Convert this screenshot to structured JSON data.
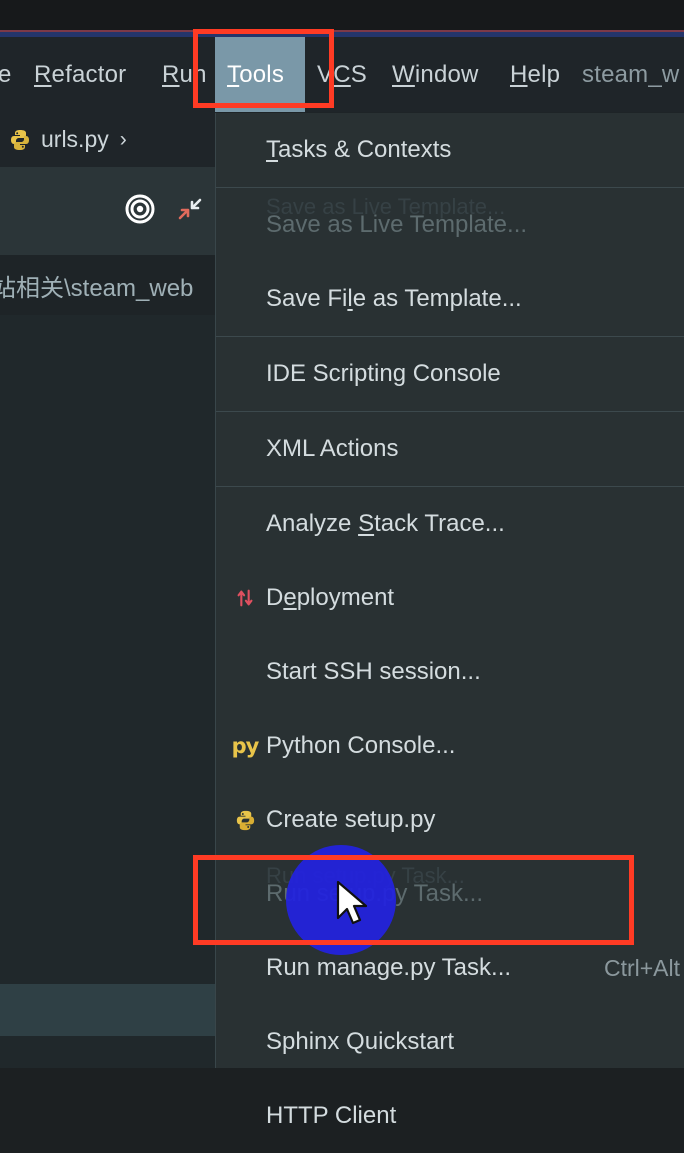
{
  "app": {
    "menubar": [
      {
        "label": "e",
        "mnemonic": "",
        "state": "clipped"
      },
      {
        "label": "Refactor",
        "mnemonic": "R",
        "state": "normal"
      },
      {
        "label": "Run",
        "mnemonic": "R",
        "state": "normal"
      },
      {
        "label": "Tools",
        "mnemonic": "T",
        "state": "selected"
      },
      {
        "label": "VCS",
        "mnemonic": "C",
        "state": "normal"
      },
      {
        "label": "Window",
        "mnemonic": "W",
        "state": "normal"
      },
      {
        "label": "Help",
        "mnemonic": "H",
        "state": "normal"
      },
      {
        "label": "steam_w",
        "mnemonic": "",
        "state": "dim"
      }
    ]
  },
  "editor": {
    "breadcrumb": {
      "icon": "python-file-icon",
      "file": "urls.py",
      "chevron": "›"
    },
    "toolbar": {
      "target_icon": "scroll-to-source-icon",
      "collapse_icon": "collapse-all-icon"
    },
    "path": "站相关\\steam_web"
  },
  "menu": {
    "title": "Tools",
    "items": [
      {
        "label": "Tasks & Contexts",
        "mnemonic": "T",
        "icon": "",
        "shortcut": "",
        "disabled": false,
        "separator_after": true,
        "ghost": ""
      },
      {
        "label": "Save as Live Template...",
        "mnemonic": "",
        "icon": "",
        "shortcut": "",
        "disabled": true,
        "separator_after": false,
        "ghost": "Save as Live Template..."
      },
      {
        "label": "Save File as Template...",
        "mnemonic": "l",
        "icon": "",
        "shortcut": "",
        "disabled": false,
        "separator_after": true,
        "ghost": ""
      },
      {
        "label": "IDE Scripting Console",
        "mnemonic": "",
        "icon": "",
        "shortcut": "",
        "disabled": false,
        "separator_after": true,
        "ghost": ""
      },
      {
        "label": "XML Actions",
        "mnemonic": "",
        "icon": "",
        "shortcut": "",
        "disabled": false,
        "separator_after": true,
        "ghost": ""
      },
      {
        "label": "Analyze Stack Trace...",
        "mnemonic": "S",
        "icon": "",
        "shortcut": "",
        "disabled": false,
        "separator_after": false,
        "ghost": ""
      },
      {
        "label": "Deployment",
        "mnemonic": "e",
        "icon": "deployment-icon",
        "shortcut": "",
        "disabled": false,
        "separator_after": false,
        "ghost": ""
      },
      {
        "label": "Start SSH session...",
        "mnemonic": "",
        "icon": "",
        "shortcut": "",
        "disabled": false,
        "separator_after": false,
        "ghost": ""
      },
      {
        "label": "Python Console...",
        "mnemonic": "",
        "icon": "py-icon",
        "shortcut": "",
        "disabled": false,
        "separator_after": false,
        "ghost": ""
      },
      {
        "label": "Create setup.py",
        "mnemonic": "",
        "icon": "python-logo-icon",
        "shortcut": "",
        "disabled": false,
        "separator_after": false,
        "ghost": ""
      },
      {
        "label": "Run setup.py Task...",
        "mnemonic": "",
        "icon": "",
        "shortcut": "",
        "disabled": true,
        "separator_after": false,
        "ghost": "Run setup.py Task..."
      },
      {
        "label": "Run manage.py Task...",
        "mnemonic": "",
        "icon": "",
        "shortcut": "Ctrl+Alt",
        "disabled": false,
        "separator_after": false,
        "ghost": ""
      },
      {
        "label": "Sphinx Quickstart",
        "mnemonic": "",
        "icon": "",
        "shortcut": "",
        "disabled": false,
        "separator_after": false,
        "ghost": ""
      },
      {
        "label": "HTTP Client",
        "mnemonic": "",
        "icon": "",
        "shortcut": "",
        "disabled": false,
        "separator_after": false,
        "ghost": ""
      }
    ]
  },
  "annotations": {
    "highlight_color": "#ff3b24",
    "click_marker_color": "#2222e0",
    "boxes": [
      {
        "name": "tools-menu-highlight",
        "target": "Tools"
      },
      {
        "name": "run-manage-task-highlight",
        "target": "Run manage.py Task..."
      }
    ]
  },
  "colors": {
    "menu_background": "#293133",
    "menubar_background": "#1f2529",
    "selected_menu_background": "#7a98a8",
    "text": "#d4dcdf",
    "disabled_text": "#5d6b6e",
    "python_yellow": "#e8c44a",
    "deployment_red": "#e05060",
    "accent_blue": "#24356b"
  }
}
